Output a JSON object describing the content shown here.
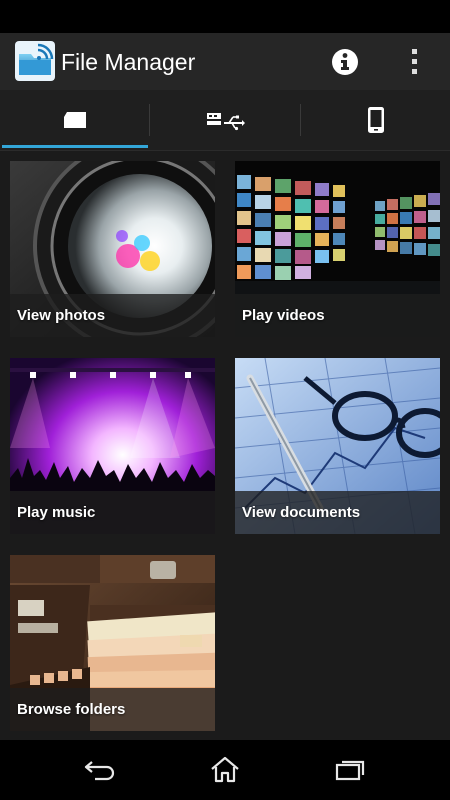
{
  "app": {
    "title": "File Manager",
    "icon": "file-manager-folder-icon",
    "colors": {
      "accent": "#33a6d8",
      "action_bar": "#262626",
      "background": "#1b1b1b"
    }
  },
  "action_bar": {
    "actions": [
      {
        "icon": "info-icon"
      },
      {
        "icon": "overflow-menu-icon"
      }
    ]
  },
  "tabs": [
    {
      "icon": "sd-card-icon",
      "selected": true
    },
    {
      "icon": "usb-icon",
      "selected": false
    },
    {
      "icon": "phone-icon",
      "selected": false
    }
  ],
  "tiles": [
    {
      "label": "View photos",
      "art": "camera-lens-image"
    },
    {
      "label": "Play videos",
      "art": "video-wall-image"
    },
    {
      "label": "Play music",
      "art": "concert-crowd-image"
    },
    {
      "label": "View documents",
      "art": "documents-glasses-pen-image"
    },
    {
      "label": "Browse folders",
      "art": "card-catalog-image"
    }
  ],
  "nav_bar": [
    {
      "icon": "back-icon"
    },
    {
      "icon": "home-icon"
    },
    {
      "icon": "recent-apps-icon"
    }
  ]
}
